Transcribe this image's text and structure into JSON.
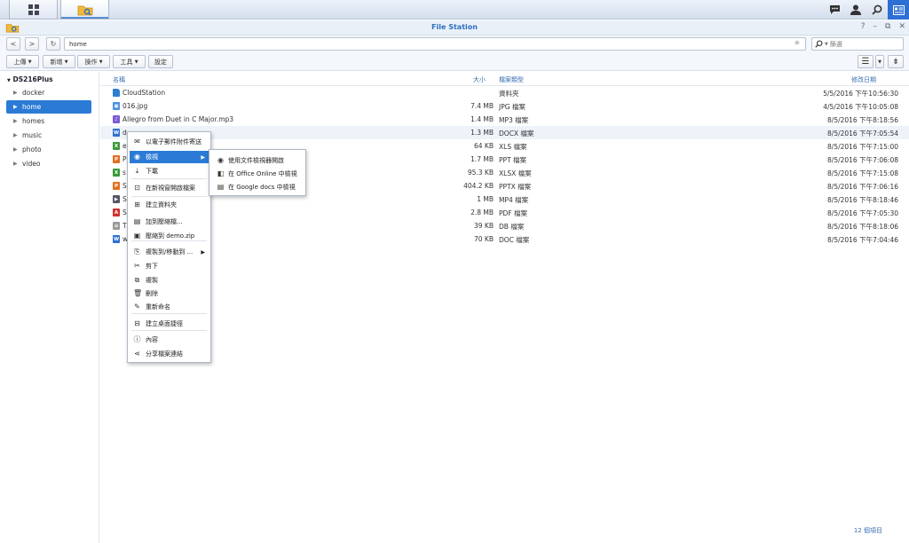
{
  "window": {
    "title": "File Station"
  },
  "address": {
    "path": "home",
    "search_placeholder": "篩選"
  },
  "toolbar": {
    "upload": "上傳",
    "create": "新增",
    "action": "操作",
    "tools": "工具",
    "settings": "設定"
  },
  "sidebar": {
    "root": "DS216Plus",
    "items": [
      {
        "label": "docker"
      },
      {
        "label": "home"
      },
      {
        "label": "homes"
      },
      {
        "label": "music"
      },
      {
        "label": "photo"
      },
      {
        "label": "video"
      }
    ]
  },
  "columns": {
    "name": "名稱",
    "size": "大小",
    "type": "檔案類型",
    "modified": "修改日期"
  },
  "files": [
    {
      "name": "CloudStation",
      "size": "",
      "type": "資料夾",
      "date": "5/5/2016 下午10:56:30",
      "icon": "folder-icon",
      "color": "#2f7fd0"
    },
    {
      "name": "016.jpg",
      "size": "7.4 MB",
      "type": "JPG 檔案",
      "date": "4/5/2016 下午10:05:08",
      "icon": "image-file-icon",
      "color": "#4a8fe0"
    },
    {
      "name": "Allegro from Duet in C Major.mp3",
      "size": "1.4 MB",
      "type": "MP3 檔案",
      "date": "8/5/2016 下午8:18:56",
      "icon": "audio-file-icon",
      "color": "#7c5cd6"
    },
    {
      "name": "d",
      "size": "1.3 MB",
      "type": "DOCX 檔案",
      "date": "8/5/2016 下午7:05:54",
      "icon": "word-file-icon",
      "color": "#2f6fd0"
    },
    {
      "name": "e",
      "size": "64 KB",
      "type": "XLS 檔案",
      "date": "8/5/2016 下午7:15:00",
      "icon": "excel-file-icon",
      "color": "#3a9a3a"
    },
    {
      "name": "P",
      "size": "1.7 MB",
      "type": "PPT 檔案",
      "date": "8/5/2016 下午7:06:08",
      "icon": "powerpoint-file-icon",
      "color": "#e07020"
    },
    {
      "name": "s",
      "size": "95.3 KB",
      "type": "XLSX 檔案",
      "date": "8/5/2016 下午7:15:08",
      "icon": "excel-file-icon",
      "color": "#3a9a3a"
    },
    {
      "name": "S",
      "size": "404.2 KB",
      "type": "PPTX 檔案",
      "date": "8/5/2016 下午7:06:16",
      "icon": "powerpoint-file-icon",
      "color": "#e07020"
    },
    {
      "name": "S          o.mp4",
      "size": "1 MB",
      "type": "MP4 檔案",
      "date": "8/5/2016 下午8:18:46",
      "icon": "video-file-icon",
      "color": "#556"
    },
    {
      "name": "S          _cht.pdf",
      "size": "2.8 MB",
      "type": "PDF 檔案",
      "date": "8/5/2016 下午7:05:30",
      "icon": "pdf-file-icon",
      "color": "#d03030"
    },
    {
      "name": "T",
      "size": "39 KB",
      "type": "DB 檔案",
      "date": "8/5/2016 下午8:18:06",
      "icon": "db-file-icon",
      "color": "#999"
    },
    {
      "name": "w          04.doc",
      "size": "70 KB",
      "type": "DOC 檔案",
      "date": "8/5/2016 下午7:04:46",
      "icon": "word-file-icon",
      "color": "#2f6fd0"
    }
  ],
  "status": {
    "count": "12 個項目"
  },
  "context_menu": {
    "items": [
      {
        "label": "以電子郵件附件寄送",
        "icon": "mail-icon",
        "sub": false
      },
      {
        "label": "檢視",
        "icon": "eye-icon",
        "sub": true
      },
      {
        "label": "下載",
        "icon": "download-icon",
        "sub": false
      },
      {
        "label": "在新視窗開啟檔案",
        "icon": "new-window-icon",
        "sub": false
      },
      {
        "label": "建立資料夾",
        "icon": "create-folder-icon",
        "sub": false
      },
      {
        "label": "加到壓縮檔...",
        "icon": "archive-icon",
        "sub": false
      },
      {
        "label": "壓縮到 demo.zip",
        "icon": "zip-icon",
        "sub": false
      },
      {
        "label": "複製到/移動到 ...",
        "icon": "copy-move-icon",
        "sub": true
      },
      {
        "label": "剪下",
        "icon": "scissors-icon",
        "sub": false
      },
      {
        "label": "複製",
        "icon": "copy-icon",
        "sub": false
      },
      {
        "label": "刪除",
        "icon": "trash-icon",
        "sub": false
      },
      {
        "label": "重新命名",
        "icon": "pencil-icon",
        "sub": false
      },
      {
        "label": "建立桌面捷徑",
        "icon": "shortcut-icon",
        "sub": false
      },
      {
        "label": "內容",
        "icon": "info-icon",
        "sub": false
      },
      {
        "label": "分享檔案連結",
        "icon": "share-icon",
        "sub": false
      }
    ]
  },
  "submenu": {
    "items": [
      {
        "label": "使用文件檢視器開啟",
        "icon": "eye-icon"
      },
      {
        "label": "在 Office Online 中檢視",
        "icon": "office-icon"
      },
      {
        "label": "在 Google docs 中檢視",
        "icon": "google-docs-icon"
      }
    ]
  }
}
